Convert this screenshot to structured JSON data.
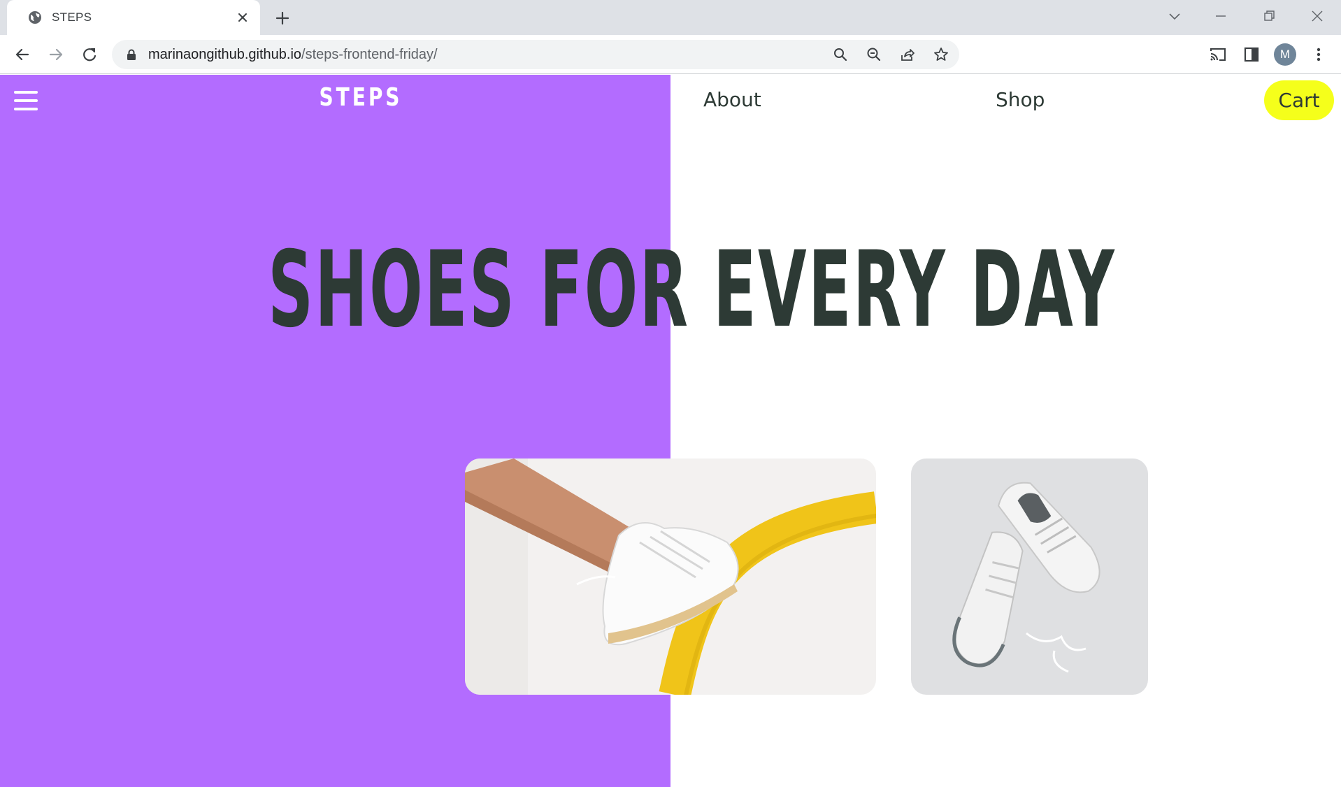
{
  "browser": {
    "tab_title": "STEPS",
    "url_host": "marinaongithub.github.io",
    "url_path": "/steps-frontend-friday/",
    "profile_initial": "M",
    "icons": [
      "globe-icon",
      "close-icon",
      "plus-icon",
      "chevron-down-icon",
      "minimize-icon",
      "restore-icon",
      "close-window-icon",
      "back-icon",
      "forward-icon",
      "reload-icon",
      "lock-icon",
      "search-icon",
      "zoom-out-icon",
      "share-icon",
      "star-icon",
      "cast-icon",
      "side-panel-icon",
      "more-icon"
    ]
  },
  "site": {
    "logo": "STEPS",
    "nav": {
      "about": "About",
      "shop": "Shop",
      "cart": "Cart"
    },
    "hero_title": "SHOES FOR EVERY DAY"
  },
  "colors": {
    "purple": "#b36cff",
    "yellow_cart": "#f5ff1b",
    "text_dark": "#2d3a35",
    "white": "#ffffff"
  }
}
